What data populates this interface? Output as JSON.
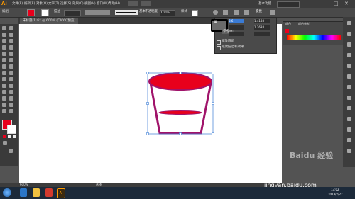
{
  "app": {
    "logo": "Ai"
  },
  "menu": [
    "文件(F)",
    "编辑(E)",
    "对象(O)",
    "文字(T)",
    "选择(S)",
    "效果(C)",
    "视图(V)",
    "窗口(W)",
    "帮助(H)"
  ],
  "workspace": "基本功能",
  "control_bar": {
    "group_label": "编组",
    "stroke_label": "描边",
    "style_label": "基本",
    "opacity_label": "不透明度",
    "opacity_value": "100%",
    "style2_label": "样式",
    "transform_label": "变换"
  },
  "document_tab": "未标题-1.ai* @ 600% (CMYK/预览)",
  "popup": {
    "tooltip": "参考点",
    "x_value": "1.4138",
    "w_value": "8.6",
    "y_value": "1.2638",
    "checkbox1": "缩放圆角",
    "checkbox2": "缩放描边和效果"
  },
  "color_panel": {
    "tab1": "颜色",
    "tab2": "颜色参考"
  },
  "status": {
    "zoom": "600%",
    "mode": "选择"
  },
  "taskbar": {
    "time": "13:02",
    "date": "2018/7/22"
  },
  "watermark": {
    "text": "jingyan.baidu.com",
    "brand": "Baidu 经验"
  },
  "colors": {
    "fill": "#e8001c",
    "stroke": "#a0136a",
    "selection": "#3b7cd4"
  }
}
